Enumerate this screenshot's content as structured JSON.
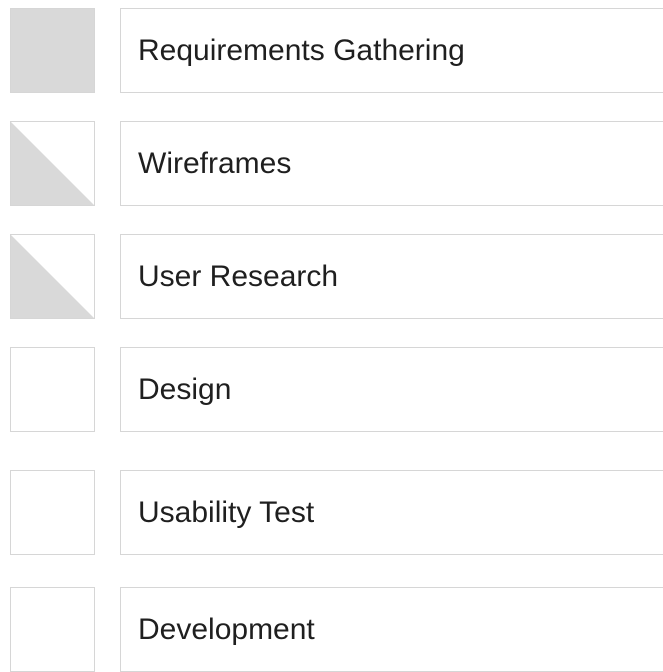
{
  "colors": {
    "border": "#d6d6d6",
    "fill": "#d9d9d9",
    "text": "#1f1f1f",
    "background": "#ffffff"
  },
  "tasks": [
    {
      "label": "Requirements Gathering",
      "status": "complete",
      "progress": 1.0
    },
    {
      "label": "Wireframes",
      "status": "in-progress",
      "progress": 0.5
    },
    {
      "label": "User Research",
      "status": "in-progress",
      "progress": 0.5
    },
    {
      "label": "Design",
      "status": "not-started",
      "progress": 0.0
    },
    {
      "label": "Usability Test",
      "status": "not-started",
      "progress": 0.0
    },
    {
      "label": "Development",
      "status": "not-started",
      "progress": 0.0
    }
  ]
}
